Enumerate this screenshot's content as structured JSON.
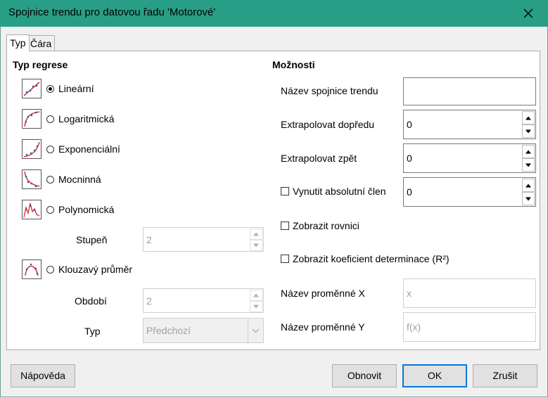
{
  "window": {
    "title": "Spojnice trendu pro datovou řadu 'Motorové'"
  },
  "tabs": [
    {
      "label": "Typ"
    },
    {
      "label": "Čára"
    }
  ],
  "regression": {
    "heading": "Typ regrese",
    "options": [
      {
        "label": "Lineární",
        "selected": true
      },
      {
        "label": "Logaritmická",
        "selected": false
      },
      {
        "label": "Exponenciální",
        "selected": false
      },
      {
        "label": "Mocninná",
        "selected": false
      },
      {
        "label": "Polynomická",
        "selected": false
      },
      {
        "label": "Klouzavý průměr",
        "selected": false
      }
    ],
    "degree": {
      "label": "Stupeň",
      "value": "2"
    },
    "period": {
      "label": "Období",
      "value": "2"
    },
    "type": {
      "label": "Typ",
      "value": "Předchozí"
    }
  },
  "options": {
    "heading": "Možnosti",
    "trendline_name": {
      "label": "Název spojnice trendu",
      "value": ""
    },
    "extrapolate_forward": {
      "label": "Extrapolovat dopředu",
      "value": "0"
    },
    "extrapolate_backward": {
      "label": "Extrapolovat zpět",
      "value": "0"
    },
    "force_intercept": {
      "label": "Vynutit absolutní člen",
      "checked": false,
      "value": "0"
    },
    "show_equation": {
      "label": "Zobrazit rovnici",
      "checked": false
    },
    "show_r2": {
      "label": "Zobrazit koeficient determinace (R²)",
      "checked": false
    },
    "x_variable": {
      "label": "Název proměnné X",
      "value": "x"
    },
    "y_variable": {
      "label": "Název proměnné Y",
      "value": "f(x)"
    }
  },
  "buttons": {
    "help": "Nápověda",
    "reset": "Obnovit",
    "ok": "OK",
    "cancel": "Zrušit"
  },
  "colors": {
    "titlebar": "#299e86",
    "default_button_border": "#0078d7",
    "curve": "#e8262e",
    "points": "#1f5fbf"
  }
}
